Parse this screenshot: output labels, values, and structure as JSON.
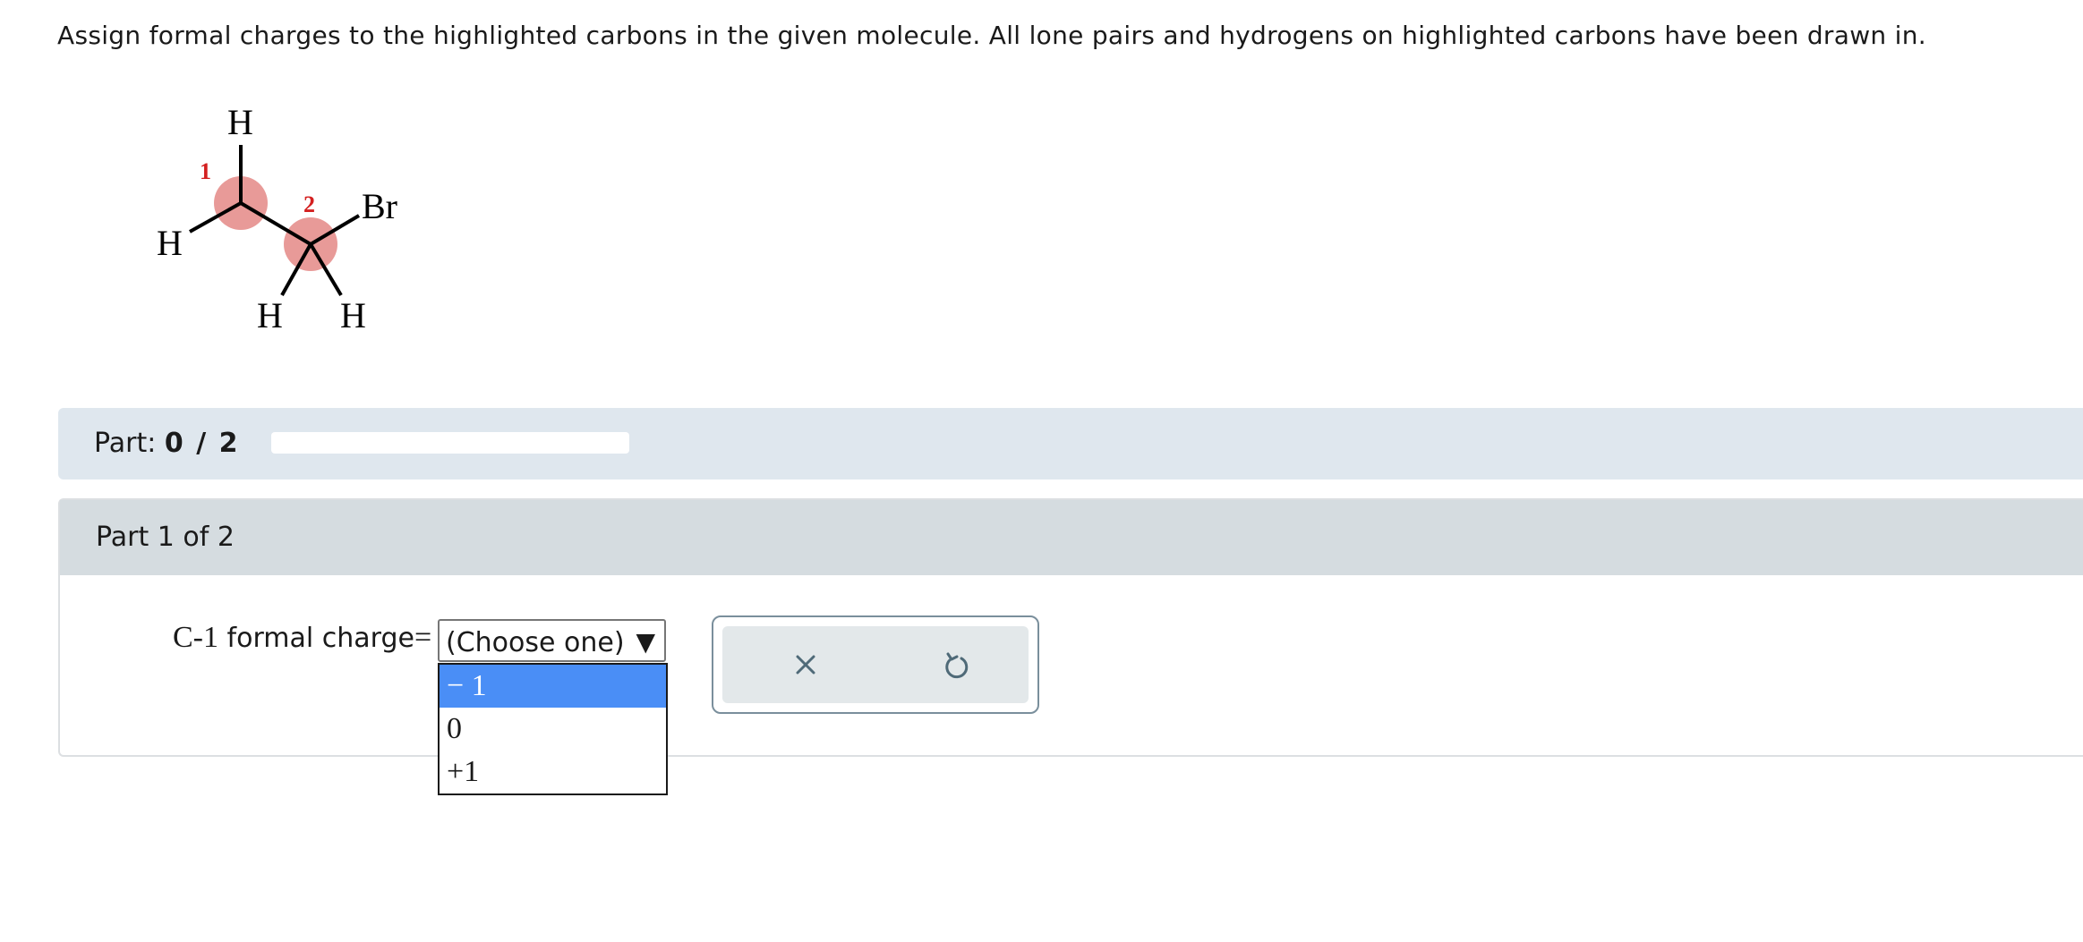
{
  "question": {
    "text": "Assign formal charges to the highlighted carbons in the given molecule. All lone pairs and hydrogens on highlighted carbons have been drawn in."
  },
  "molecule": {
    "atoms": {
      "h_top": "H",
      "h_left": "H",
      "br": "Br",
      "h_bottom_left": "H",
      "h_bottom_right": "H"
    },
    "carbon_numbers": {
      "c1": "1",
      "c2": "2"
    },
    "highlight_color": "#e89a98",
    "number_color": "#d42020"
  },
  "part_bar": {
    "label": "Part:",
    "score": "0 / 2",
    "progress": 0
  },
  "part_panel": {
    "header": "Part 1 of 2",
    "formula_prefix": "C-1",
    "formula_text": "formal charge",
    "equals": "=",
    "select": {
      "value": "(Choose one)",
      "arrow": "▼"
    },
    "dropdown_options": [
      {
        "label": "− 1",
        "selected": true
      },
      {
        "label": "0",
        "selected": false
      },
      {
        "label": "+1",
        "selected": false
      }
    ]
  },
  "tools": {
    "clear_icon": "close-icon",
    "reset_icon": "undo-icon"
  },
  "colors": {
    "part_bar_bg": "#dfe7ee",
    "part_header_bg": "#d5dce0",
    "selected_option": "#4a8ef6",
    "tool_icon": "#4f6a78"
  }
}
